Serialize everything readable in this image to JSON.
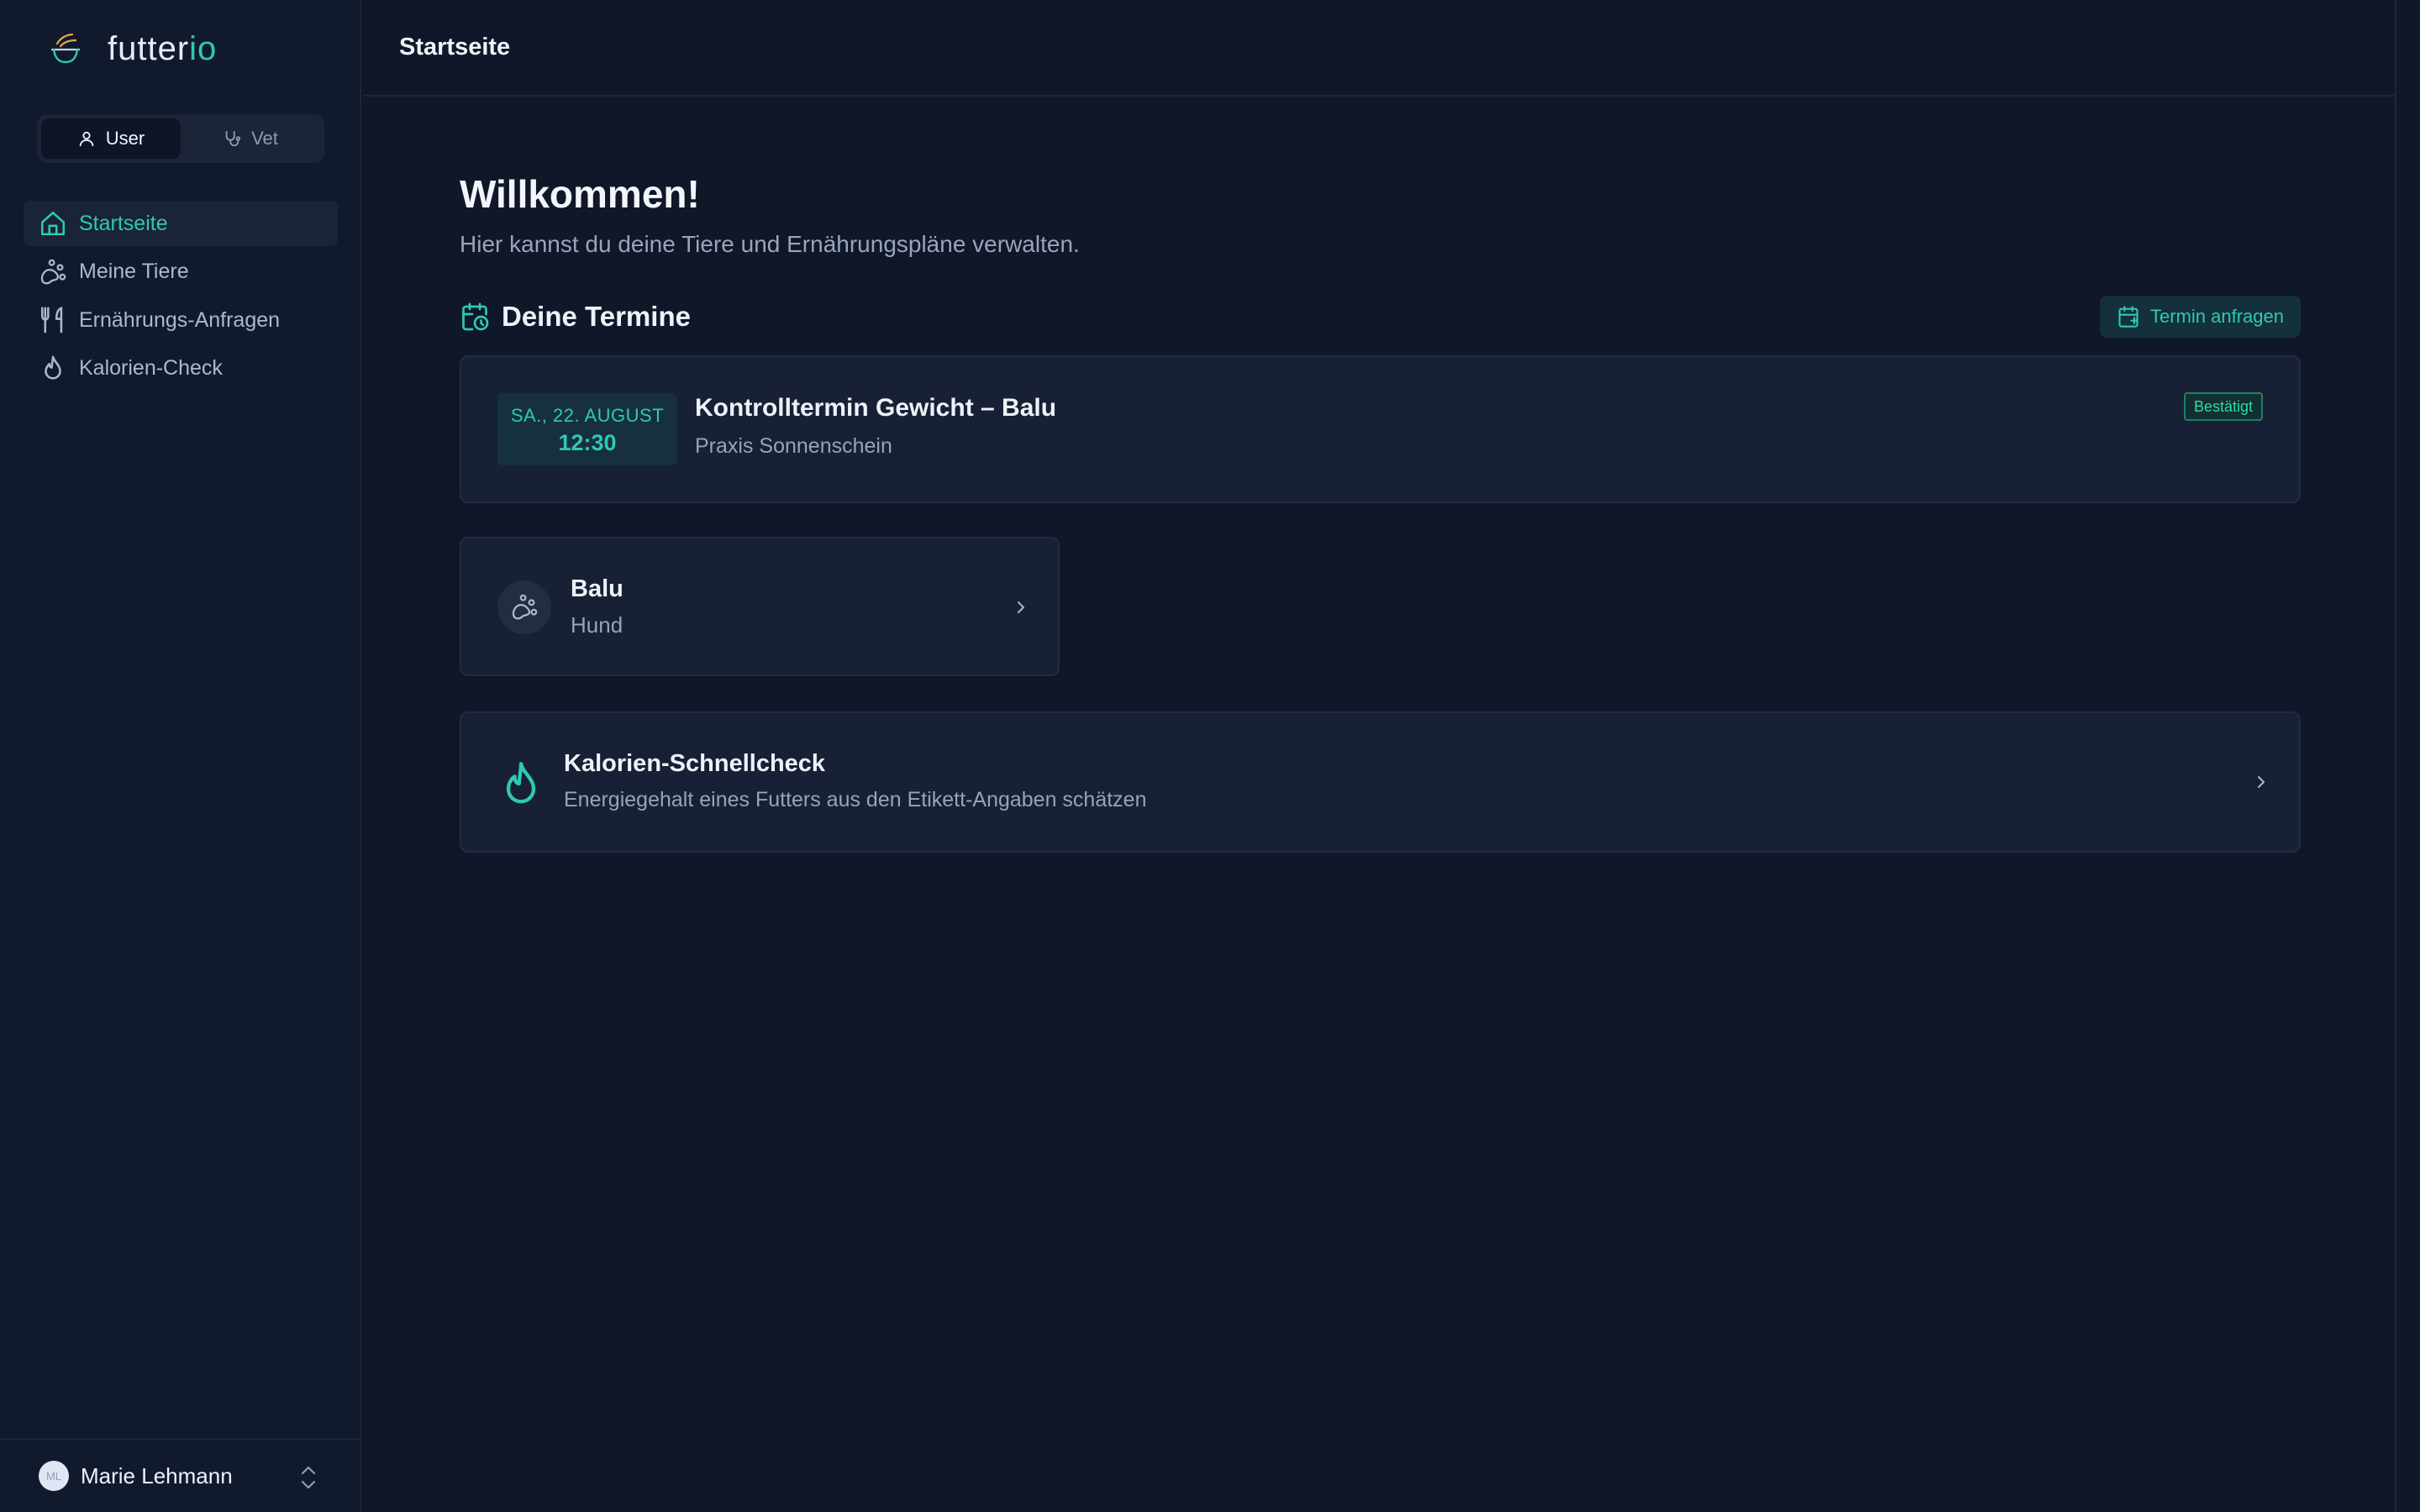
{
  "app": {
    "brand_part1": "futter",
    "brand_part2": "io",
    "colors": {
      "accent": "#2ec9b3",
      "background": "#0f1729",
      "sidebar": "#111a2d",
      "card": "#172034",
      "success": "#2ed8a6"
    }
  },
  "role_toggle": {
    "options": [
      {
        "label": "User",
        "icon": "user-icon",
        "selected": true
      },
      {
        "label": "Vet",
        "icon": "stethoscope-icon",
        "selected": false
      }
    ]
  },
  "sidebar": {
    "items": [
      {
        "label": "Startseite",
        "icon": "home-icon",
        "active": true
      },
      {
        "label": "Meine Tiere",
        "icon": "paw-icon",
        "active": false
      },
      {
        "label": "Ernährungs-Anfragen",
        "icon": "utensils-icon",
        "active": false
      },
      {
        "label": "Kalorien-Check",
        "icon": "flame-icon",
        "active": false
      }
    ]
  },
  "user": {
    "initials": "ML",
    "name": "Marie Lehmann"
  },
  "header": {
    "title": "Startseite"
  },
  "main": {
    "welcome_title": "Willkommen!",
    "welcome_subtitle": "Hier kannst du deine Tiere und Ernährungspläne verwalten.",
    "appointments": {
      "title": "Deine Termine",
      "request_button": "Termin anfragen",
      "items": [
        {
          "date": "SA., 22. AUGUST",
          "time": "12:30",
          "title": "Kontrolltermin Gewicht – Balu",
          "location": "Praxis Sonnenschein",
          "status": "Bestätigt"
        }
      ]
    },
    "pets": [
      {
        "name": "Balu",
        "species": "Hund"
      }
    ],
    "calorie_check": {
      "title": "Kalorien-Schnellcheck",
      "subtitle": "Energiegehalt eines Futters aus den Etikett-Angaben schätzen"
    }
  }
}
